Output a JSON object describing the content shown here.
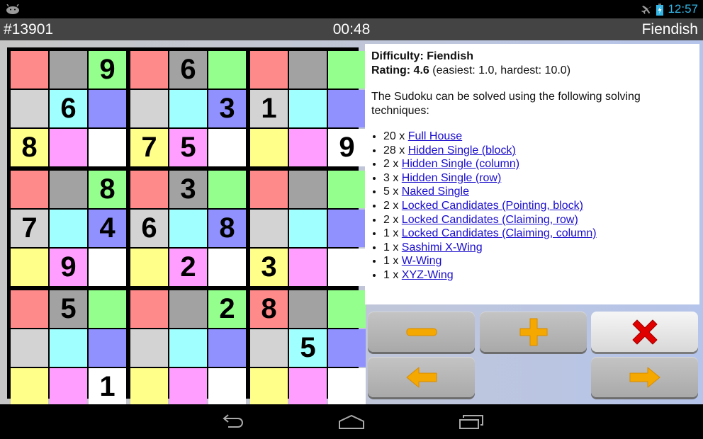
{
  "status_bar": {
    "left_icon": "android-debug-icon",
    "icons": [
      "airplane-mode-icon",
      "battery-charging-icon"
    ],
    "time": "12:57"
  },
  "title_bar": {
    "puzzle_id": "#13901",
    "timer": "00:48",
    "difficulty": "Fiendish"
  },
  "board": {
    "colors": {
      "R": "#ff8a8a",
      "G": "#a2a2a2",
      "N": "#94ff8c",
      "L": "#d3d3d3",
      "C": "#a0ffff",
      "B": "#9090ff",
      "Y": "#ffff8a",
      "P": "#ff9eff",
      "W": "#ffffff"
    },
    "color_pattern": [
      [
        "R",
        "G",
        "N",
        "R",
        "G",
        "N",
        "R",
        "G",
        "N"
      ],
      [
        "L",
        "C",
        "B",
        "L",
        "C",
        "B",
        "L",
        "C",
        "B"
      ],
      [
        "Y",
        "P",
        "W",
        "Y",
        "P",
        "W",
        "Y",
        "P",
        "W"
      ],
      [
        "R",
        "G",
        "N",
        "R",
        "G",
        "N",
        "R",
        "G",
        "N"
      ],
      [
        "L",
        "C",
        "B",
        "L",
        "C",
        "B",
        "L",
        "C",
        "B"
      ],
      [
        "Y",
        "P",
        "W",
        "Y",
        "P",
        "W",
        "Y",
        "P",
        "W"
      ],
      [
        "R",
        "G",
        "N",
        "R",
        "G",
        "N",
        "R",
        "G",
        "N"
      ],
      [
        "L",
        "C",
        "B",
        "L",
        "C",
        "B",
        "L",
        "C",
        "B"
      ],
      [
        "Y",
        "P",
        "W",
        "Y",
        "P",
        "W",
        "Y",
        "P",
        "W"
      ]
    ],
    "values": [
      [
        "",
        "",
        "9",
        "",
        "6",
        "",
        "",
        "",
        ""
      ],
      [
        "",
        "6",
        "",
        "",
        "",
        "3",
        "1",
        "",
        ""
      ],
      [
        "8",
        "",
        "",
        "7",
        "5",
        "",
        "",
        "",
        "9"
      ],
      [
        "",
        "",
        "8",
        "",
        "3",
        "",
        "",
        "",
        ""
      ],
      [
        "7",
        "",
        "4",
        "6",
        "",
        "8",
        "",
        "",
        ""
      ],
      [
        "",
        "9",
        "",
        "",
        "2",
        "",
        "3",
        "",
        ""
      ],
      [
        "",
        "5",
        "",
        "",
        "",
        "2",
        "8",
        "",
        ""
      ],
      [
        "",
        "",
        "",
        "",
        "",
        "",
        "",
        "5",
        ""
      ],
      [
        "",
        "",
        "1",
        "",
        "",
        "",
        "",
        "",
        ""
      ]
    ]
  },
  "info": {
    "difficulty_label": "Difficulty: Fiendish",
    "rating_label": "Rating: 4.6",
    "rating_range": " (easiest: 1.0, hardest: 10.0)",
    "intro": "The Sudoku can be solved using the following solving techniques:",
    "techniques": [
      {
        "count": "20 x ",
        "name": "Full House"
      },
      {
        "count": "28 x ",
        "name": "Hidden Single (block)"
      },
      {
        "count": "2 x ",
        "name": "Hidden Single (column)"
      },
      {
        "count": "3 x ",
        "name": "Hidden Single (row)"
      },
      {
        "count": "5 x ",
        "name": "Naked Single"
      },
      {
        "count": "2 x ",
        "name": "Locked Candidates (Pointing, block)"
      },
      {
        "count": "2 x ",
        "name": "Locked Candidates (Claiming, row)"
      },
      {
        "count": "1 x ",
        "name": "Locked Candidates (Claiming, column)"
      },
      {
        "count": "1 x ",
        "name": "Sashimi X-Wing"
      },
      {
        "count": "1 x ",
        "name": "W-Wing"
      },
      {
        "count": "1 x ",
        "name": "XYZ-Wing"
      }
    ],
    "link_color": "#1a0dcc"
  },
  "controls": {
    "buttons": [
      {
        "id": "decrease",
        "icon": "minus-icon"
      },
      {
        "id": "increase",
        "icon": "plus-icon"
      },
      {
        "id": "close",
        "icon": "close-x-icon"
      },
      {
        "id": "previous",
        "icon": "arrow-left-icon"
      },
      {
        "id": "next",
        "icon": "arrow-right-icon"
      }
    ],
    "accent_color": "#f5a800",
    "close_color": "#dd0000"
  },
  "nav_bar": {
    "buttons": [
      "back-icon",
      "home-icon",
      "recent-apps-icon"
    ]
  }
}
